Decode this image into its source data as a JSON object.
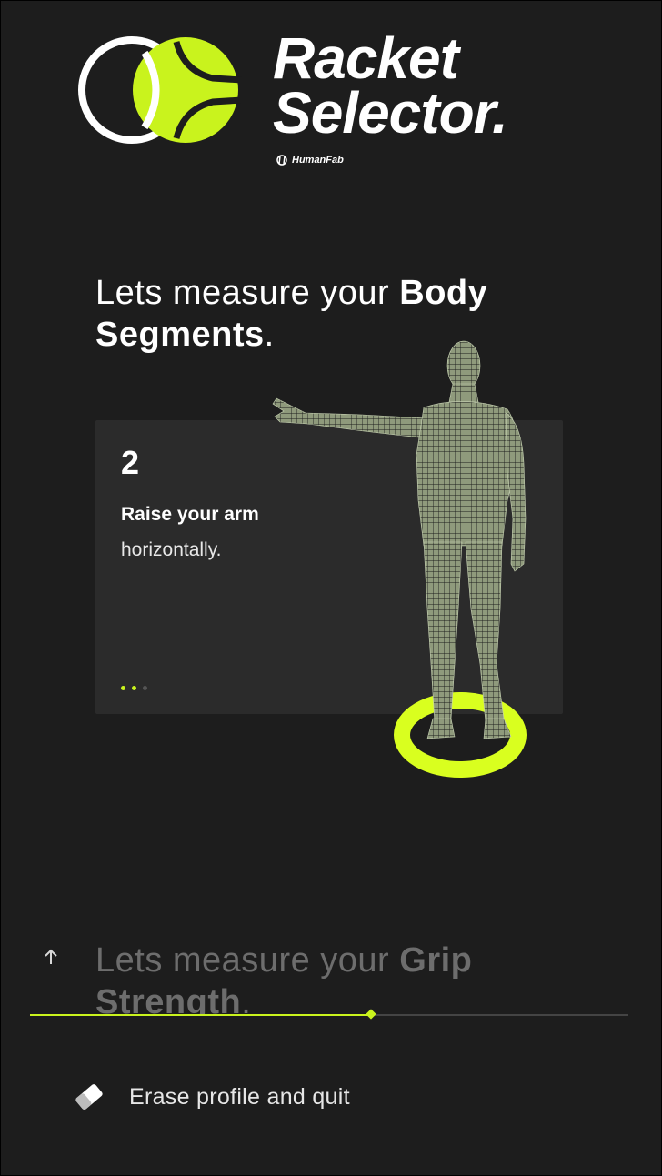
{
  "app": {
    "title_line1": "Racket",
    "title_line2": "Selector.",
    "brand": "HumanFab",
    "logo_icon": "tennis-ball-logo-icon"
  },
  "section_current": {
    "heading_prefix": "Lets measure your ",
    "heading_bold": "Body Segments",
    "heading_suffix": "."
  },
  "step_card": {
    "number": "2",
    "title": "Raise your arm",
    "text": "horizontally.",
    "dots_total": 3,
    "dots_active": 2
  },
  "section_next": {
    "heading_prefix": "Lets measure your ",
    "heading_bold": "Grip Strength",
    "heading_suffix": "."
  },
  "progress": {
    "fraction": 0.57
  },
  "actions": {
    "erase_label": "Erase profile and quit",
    "erase_icon": "eraser-icon",
    "up_icon": "arrow-up-icon"
  },
  "colors": {
    "accent": "#c9f31d",
    "background": "#1d1d1d",
    "card": "#2b2b2b",
    "muted_text": "#6d6d6d"
  }
}
